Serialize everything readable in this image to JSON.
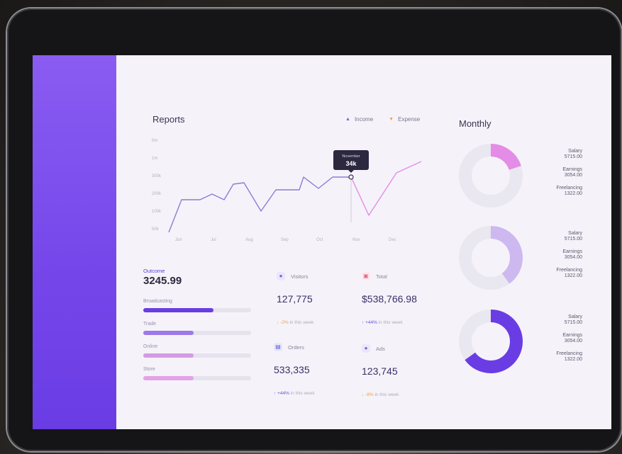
{
  "reports": {
    "title": "Reports",
    "legend": [
      {
        "label": "Income",
        "mark": "▲",
        "color": "#7a5ae8"
      },
      {
        "label": "Expense",
        "mark": "▼",
        "color": "#f2a03a"
      }
    ],
    "y_ticks": [
      "5m",
      "1m",
      "300k",
      "200k",
      "100k",
      "50k"
    ],
    "x_ticks": [
      "Jun",
      "Jul",
      "Aug",
      "Sep",
      "Oct",
      "Nov",
      "Dec"
    ],
    "tooltip": {
      "label": "November",
      "value": "34k"
    }
  },
  "outcome": {
    "label": "Outcome",
    "value": "3245.99",
    "bars": [
      {
        "label": "Broadcasting",
        "fraction": 0.65,
        "color": "#6a3ce4"
      },
      {
        "label": "Trade",
        "fraction": 0.47,
        "color": "#9d7ae8"
      },
      {
        "label": "Online",
        "fraction": 0.47,
        "color": "#d39be6"
      },
      {
        "label": "Store",
        "fraction": 0.47,
        "color": "#e2a4e6"
      }
    ]
  },
  "cards": {
    "visitors": {
      "label": "Visitors",
      "value": "127,775",
      "trend_arrow": "↓",
      "trend_value": "-2%",
      "trend_text": "in this week"
    },
    "total": {
      "label": "Total",
      "value": "$538,766.98",
      "trend_arrow": "↑",
      "trend_value": "+44%",
      "trend_text": "in this week"
    },
    "orders": {
      "label": "Orders",
      "value": "533,335",
      "trend_arrow": "↑",
      "trend_value": "+44%",
      "trend_text": "in this week"
    },
    "ads": {
      "label": "Ads",
      "value": "123,745",
      "trend_arrow": "↓",
      "trend_value": "-8%",
      "trend_text": "in this week"
    }
  },
  "monthly": {
    "title": "Monthly",
    "donuts": [
      {
        "fraction": 0.2,
        "color": "#e48ce6",
        "items": [
          {
            "label": "Salary",
            "value": "5715.00"
          },
          {
            "label": "Earnings",
            "value": "3054.00"
          },
          {
            "label": "Freelancing",
            "value": "1322.00"
          }
        ]
      },
      {
        "fraction": 0.4,
        "color": "#cdb8f0",
        "items": [
          {
            "label": "Salary",
            "value": "5715.00"
          },
          {
            "label": "Earnings",
            "value": "3054.00"
          },
          {
            "label": "Freelancing",
            "value": "1322.00"
          }
        ]
      },
      {
        "fraction": 0.65,
        "color": "#6a3ce4",
        "items": [
          {
            "label": "Salary",
            "value": "5715.00"
          },
          {
            "label": "Earnings",
            "value": "3054.00"
          },
          {
            "label": "Freelancing",
            "value": "1322.00"
          }
        ]
      }
    ]
  },
  "colors": {
    "accent": "#6a3ce4",
    "sidebar": "#7a4ff0",
    "income_line": "#8f7ad8",
    "expense_line": "#e48ce6"
  }
}
